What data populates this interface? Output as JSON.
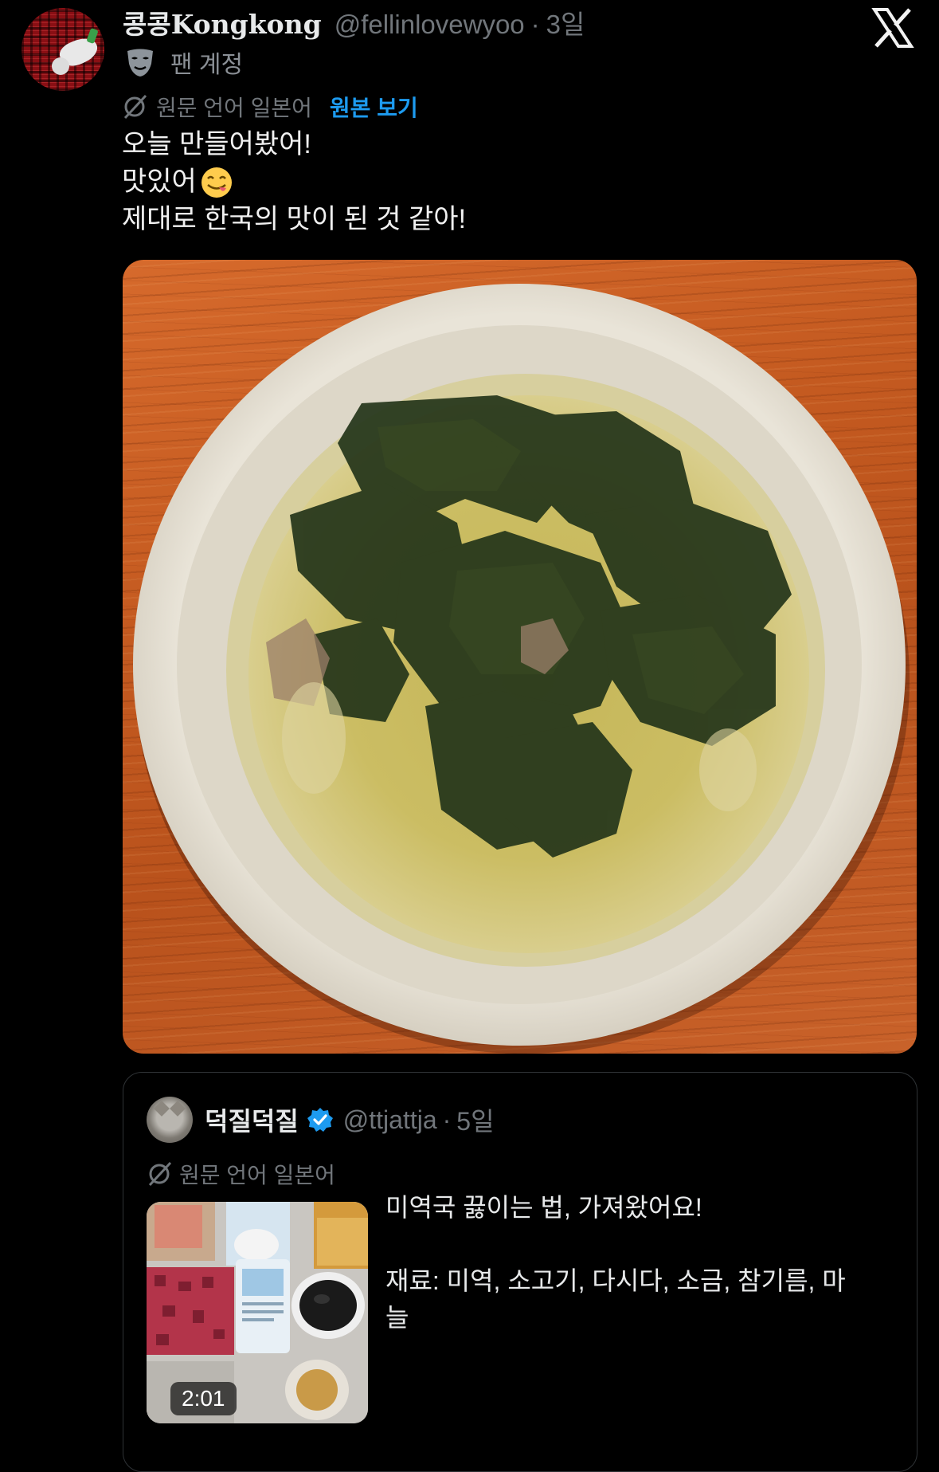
{
  "post": {
    "display_name": "콩콩Kongkong",
    "handle": "@fellinlovewyoo",
    "separator": "·",
    "time": "3일",
    "account_label": "팬 계정",
    "translated_from": "원문 언어 일본어",
    "show_original": "원본 보기",
    "text_lines": [
      "오늘 만들어봤어!",
      "맛있어",
      "제대로 한국의 맛이 된 것 같아!"
    ],
    "icons": {
      "brand": "x-logo-icon",
      "account": "mask-icon",
      "translate": "translate-off-icon",
      "emoji": "yum-face-emoji"
    },
    "image": "seaweed-soup-photo"
  },
  "quoted_post": {
    "display_name": "덕질덕질",
    "handle": "@ttjattja",
    "separator": "·",
    "time": "5일",
    "translated_from": "원문 언어 일본어",
    "video_duration": "2:01",
    "text_line_1": "미역국 끓이는 법, 가져왔어요!",
    "text_line_2": "재료: 미역, 소고기, 다시다, 소금, 참기름, 마",
    "text_line_3": "늘",
    "icons": {
      "verified": "verified-badge-icon",
      "translate": "translate-off-icon"
    }
  },
  "colors": {
    "background": "#000000",
    "text": "#e7e9ea",
    "secondary_text": "#71767b",
    "link": "#1d9bf0",
    "verified": "#1d9bf0",
    "border": "#2f3336"
  }
}
